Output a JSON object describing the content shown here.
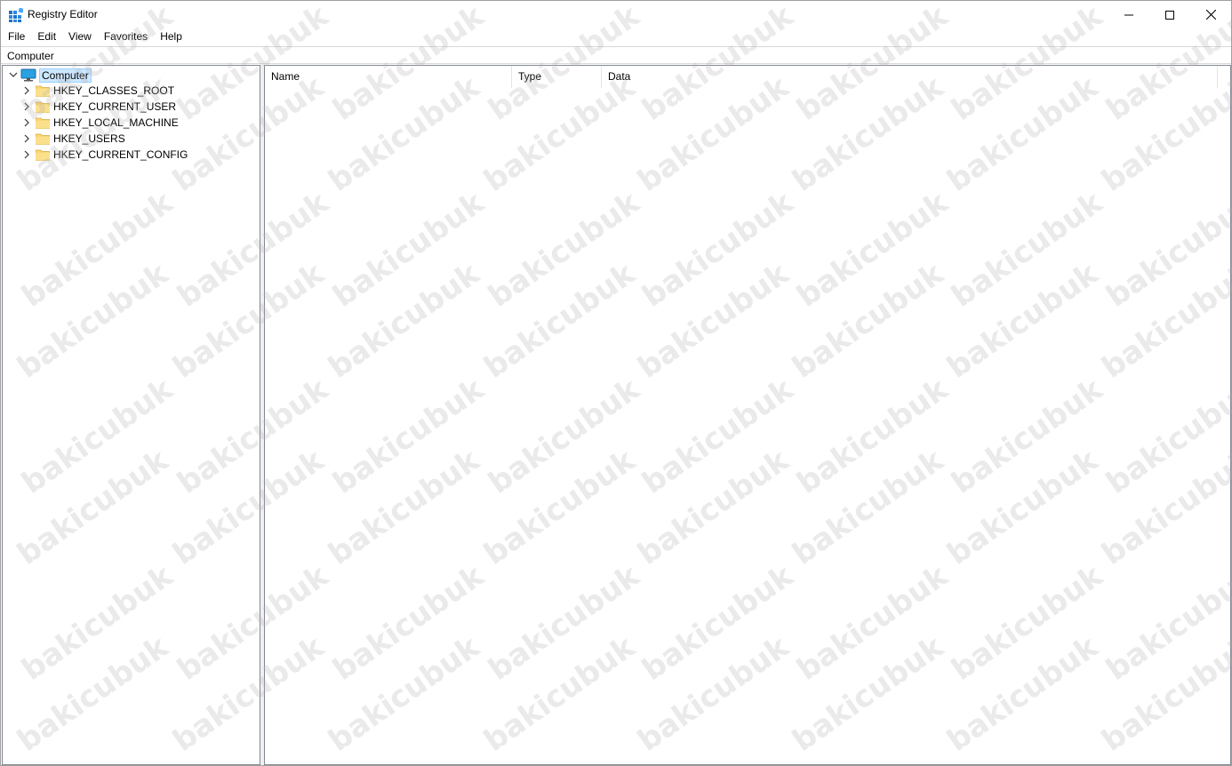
{
  "window": {
    "title": "Registry Editor"
  },
  "icons": {
    "app": "registry-editor-icon",
    "minimize": "minimize-icon",
    "maximize": "maximize-icon",
    "close": "close-icon",
    "expand": "chevron-right-icon",
    "collapse": "chevron-down-icon",
    "computer": "computer-icon",
    "folder": "folder-icon"
  },
  "menu": {
    "items": [
      "File",
      "Edit",
      "View",
      "Favorites",
      "Help"
    ]
  },
  "address": {
    "value": "Computer"
  },
  "tree": {
    "root": "Computer",
    "children": [
      "HKEY_CLASSES_ROOT",
      "HKEY_CURRENT_USER",
      "HKEY_LOCAL_MACHINE",
      "HKEY_USERS",
      "HKEY_CURRENT_CONFIG"
    ]
  },
  "list": {
    "columns": [
      "Name",
      "Type",
      "Data"
    ]
  },
  "watermark": "bakicubuk",
  "colors": {
    "selection": "#cce8ff",
    "folder": "#f8d775"
  }
}
